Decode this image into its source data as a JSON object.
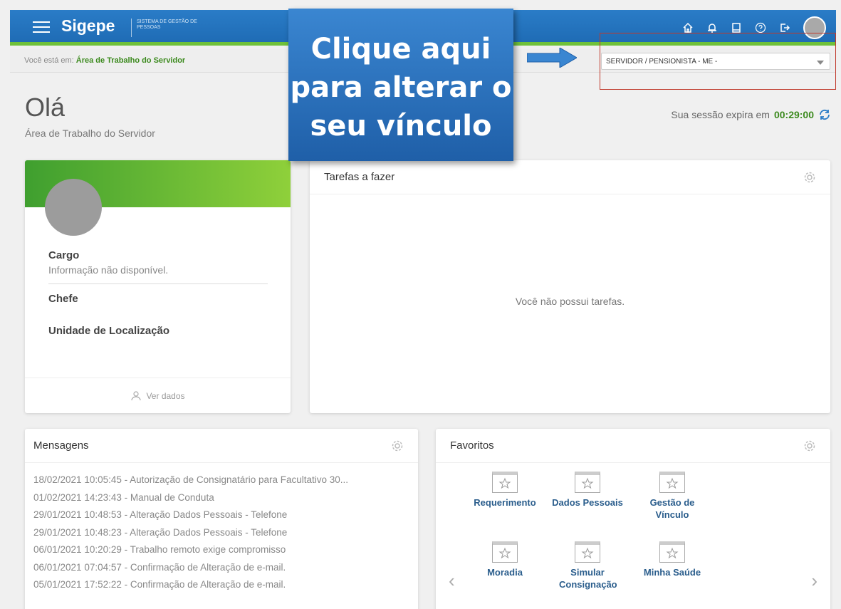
{
  "header": {
    "brand": "Sigepe",
    "brand_sub": "SISTEMA DE GESTÃO DE PESSOAS"
  },
  "breadcrumb": {
    "prefix": "Você está em:",
    "current": "Área de Trabalho do Servidor"
  },
  "profile_select": {
    "value": "SERVIDOR / PENSIONISTA - ME -"
  },
  "callout": {
    "text": "Clique aqui para alterar o seu vínculo"
  },
  "page": {
    "greeting": "Olá",
    "subtitle": "Área de Trabalho do Servidor",
    "session_label": "Sua sessão expira em",
    "session_time": "00:29:00"
  },
  "profile_card": {
    "cargo_label": "Cargo",
    "cargo_value": "Informação não disponível.",
    "chefe_label": "Chefe",
    "unidade_label": "Unidade de Localização",
    "ver_dados": "Ver dados"
  },
  "tasks": {
    "title": "Tarefas a fazer",
    "empty": "Você não possui tarefas."
  },
  "messages": {
    "title": "Mensagens",
    "items": [
      "18/02/2021 10:05:45 - Autorização de Consignatário para Facultativo 30...",
      "01/02/2021 14:23:43 - Manual de Conduta",
      "29/01/2021 10:48:53 - Alteração Dados Pessoais - Telefone",
      "29/01/2021 10:48:23 - Alteração Dados Pessoais - Telefone",
      "06/01/2021 10:20:29 - Trabalho remoto exige compromisso",
      "06/01/2021 07:04:57 - Confirmação de Alteração de e-mail.",
      "05/01/2021 17:52:22 - Confirmação de Alteração de e-mail."
    ]
  },
  "favorites": {
    "title": "Favoritos",
    "items": [
      "Requerimento",
      "Dados Pessoais",
      "Gestão de Vínculo",
      "Moradia",
      "Simular Consignação",
      "Minha Saúde"
    ],
    "prev": "‹",
    "next": "›"
  },
  "colors": {
    "header_blue": "#1f6cb5",
    "accent_green": "#3c8a1e",
    "highlight_red": "#c0392b"
  },
  "icons": [
    "menu-icon",
    "home-icon",
    "bell-icon",
    "book-icon",
    "help-icon",
    "logout-icon",
    "refresh-icon",
    "gear-icon",
    "user-icon",
    "star-icon"
  ]
}
